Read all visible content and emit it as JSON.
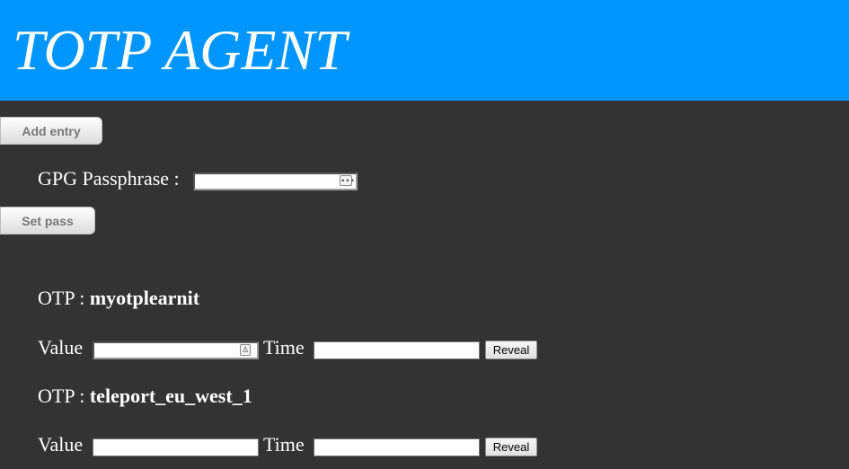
{
  "header": {
    "title": "TOTP AGENT",
    "background_color": "#0095ff"
  },
  "page_background_color": "#333333",
  "actions": {
    "add_entry_label": "Add entry",
    "set_pass_label": "Set pass"
  },
  "passphrase": {
    "label": "GPG Passphrase :",
    "value": "",
    "icon": "password-dots-icon"
  },
  "otps": [
    {
      "prefix": "OTP : ",
      "name": "myotplearnit",
      "value_label": "Value",
      "value": "",
      "value_icon": "person-card-icon",
      "time_label": "Time",
      "time": "",
      "reveal_label": "Reveal"
    },
    {
      "prefix": "OTP : ",
      "name": "teleport_eu_west_1",
      "value_label": "Value",
      "value": "",
      "time_label": "Time",
      "time": "",
      "reveal_label": "Reveal"
    }
  ]
}
